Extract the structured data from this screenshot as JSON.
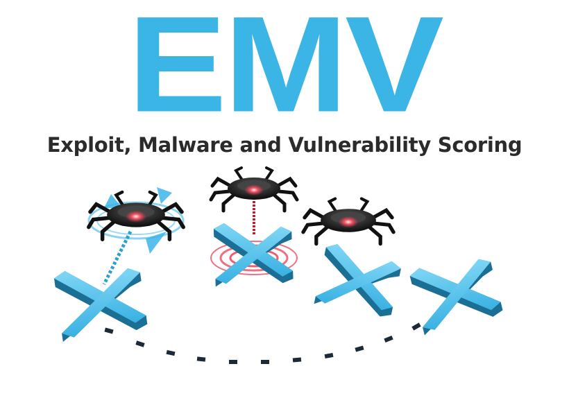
{
  "logo": {
    "title": "EMV",
    "subtitle": "Exploit, Malware and Vulnerability Scoring"
  },
  "colors": {
    "brand": "#3bb5e6",
    "brand_dark": "#1e7fa8",
    "text": "#2b2b2b",
    "malware_glow": "#e8344a"
  },
  "icons": {
    "target": "x-cross-icon",
    "malware": "bug-drone-icon",
    "link": "dashed-path-icon"
  }
}
